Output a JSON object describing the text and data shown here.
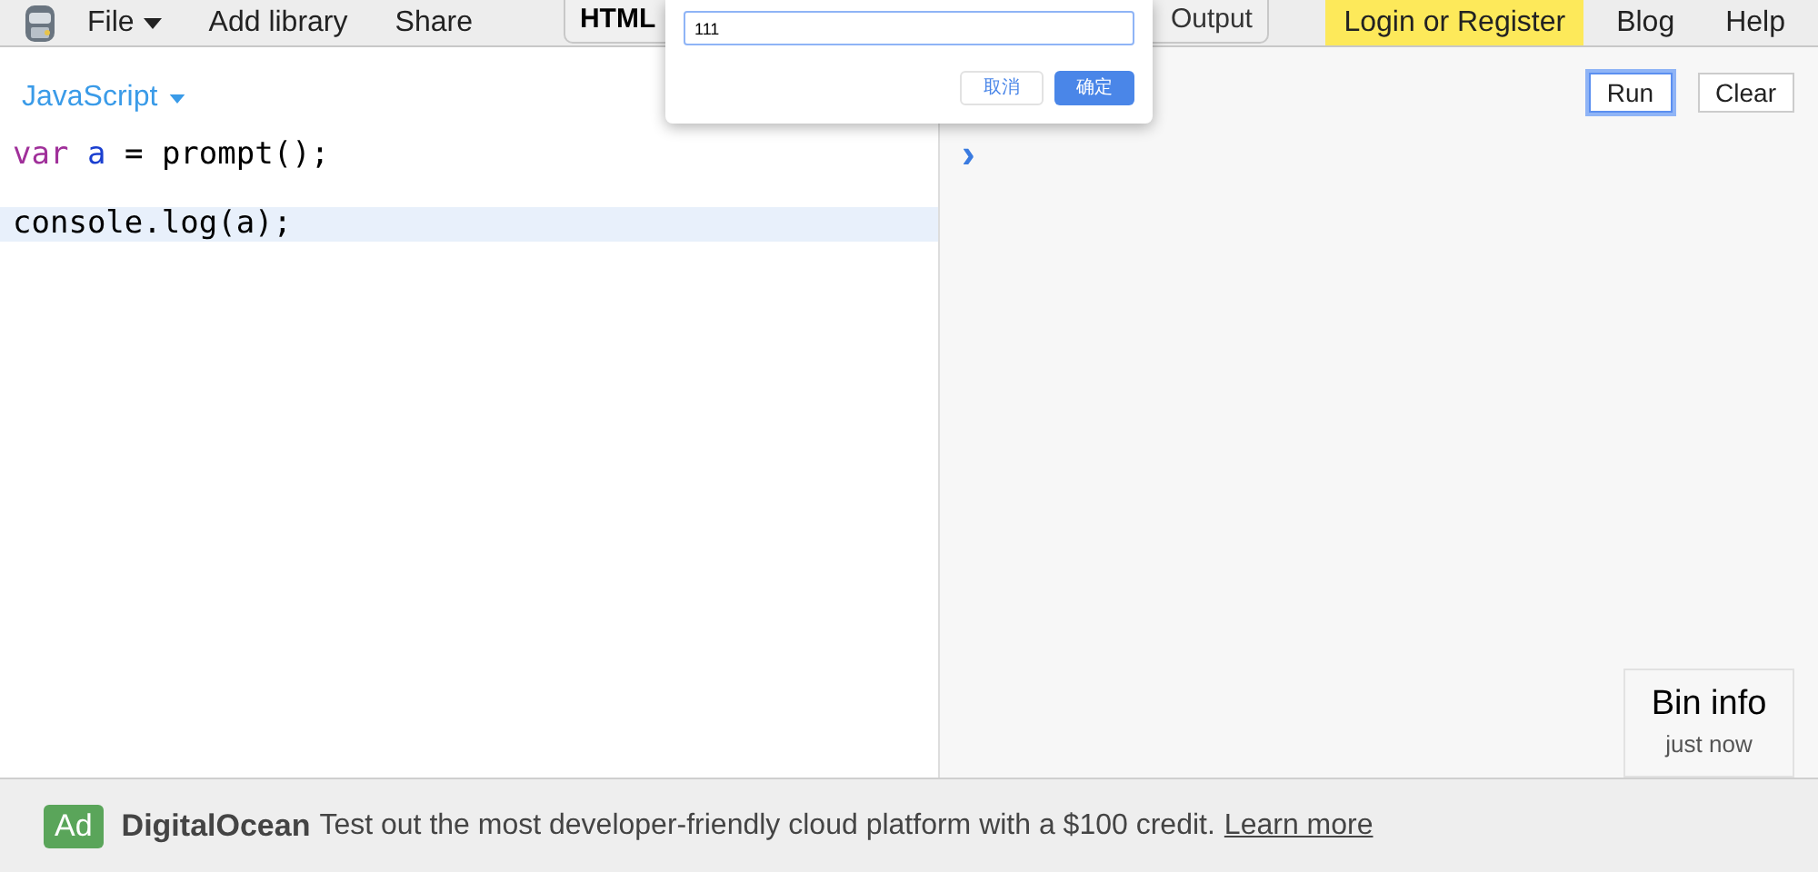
{
  "menu": [
    {
      "label": "File",
      "caret": true
    },
    {
      "label": "Add library",
      "caret": false
    },
    {
      "label": "Share",
      "caret": false
    }
  ],
  "panel_tabs": [
    {
      "label": "HTML",
      "selected": true
    },
    {
      "label": "Output",
      "selected": false
    }
  ],
  "right_menu": [
    {
      "label": "Login or Register",
      "highlighted": true
    },
    {
      "label": "Blog",
      "highlighted": false
    },
    {
      "label": "Help",
      "highlighted": false
    }
  ],
  "prompt_dialog": {
    "value": "111",
    "buttons": [
      {
        "label": "取消",
        "primary": false
      },
      {
        "label": "确定",
        "primary": true
      }
    ]
  },
  "editor": {
    "language": "JavaScript",
    "lines": [
      {
        "active": false,
        "tokens": [
          {
            "kind": "keyword",
            "text": "var"
          },
          {
            "kind": "variable",
            "text": "a"
          },
          {
            "kind": "plain",
            "text": "= prompt();"
          }
        ]
      },
      {
        "active": false
      },
      {
        "active": true,
        "tokens": [
          {
            "kind": "plain",
            "text": "console.log(a);"
          }
        ]
      }
    ]
  },
  "console": {
    "buttons": [
      {
        "label": "Run",
        "focused": true
      },
      {
        "label": "Clear",
        "focused": false
      }
    ],
    "prompt": "›"
  },
  "bin_info": {
    "title": "Bin info",
    "subtitle": "just now"
  },
  "ad": {
    "badge": "Ad",
    "brand": "DigitalOcean",
    "text": "Test out the most developer-friendly cloud platform with a $100 credit.",
    "link": "Learn more"
  }
}
